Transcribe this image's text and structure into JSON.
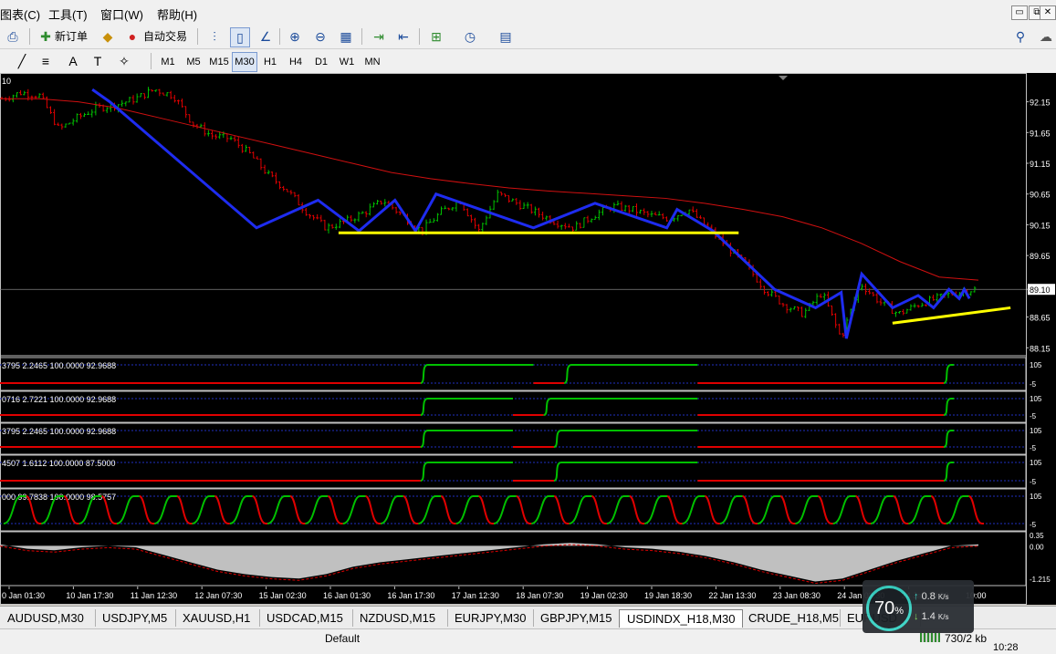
{
  "menu": {
    "items": [
      "图表(C)",
      "工具(T)",
      "窗口(W)",
      "帮助(H)"
    ],
    "window_buttons": [
      "▭",
      "⧉",
      "✕"
    ]
  },
  "toolbar": {
    "new_order_label": "新订单",
    "auto_trade_label": "自动交易",
    "icons": [
      "print-icon",
      "new-order-icon",
      "history-icon",
      "auto-trade-icon",
      "bar-chart-icon",
      "candle-chart-icon",
      "line-chart-icon",
      "zoom-in-icon",
      "zoom-out-icon",
      "tile-windows-icon",
      "auto-scroll-icon",
      "chart-shift-icon",
      "indicators-icon",
      "periods-icon",
      "templates-icon",
      "search-icon",
      "chat-icon"
    ]
  },
  "timeframes": [
    "M1",
    "M5",
    "M15",
    "M30",
    "H1",
    "H4",
    "D1",
    "W1",
    "MN"
  ],
  "active_timeframe": "M30",
  "chart_data": [
    {
      "type": "line",
      "title": "",
      "corner_label": "10",
      "yticks": [
        "92.15",
        "91.65",
        "91.15",
        "90.65",
        "90.15",
        "89.65",
        "89.10",
        "88.65",
        "88.15"
      ],
      "current_price_label": "89.10",
      "ylim": [
        88.05,
        92.5
      ],
      "xticks": [
        "0 Jan 01:30",
        "10 Jan 17:30",
        "11 Jan 12:30",
        "12 Jan 07:30",
        "15 Jan 02:30",
        "16 Jan 01:30",
        "16 Jan 17:30",
        "17 Jan 12:30",
        "18 Jan 07:30",
        "19 Jan 02:30",
        "19 Jan 18:30",
        "22 Jan 13:30",
        "23 Jan 08:30",
        "24 Jan 03:30",
        "24 Jan 19:30",
        "10:00"
      ],
      "price_series": [
        92.2,
        92.3,
        92.25,
        91.7,
        91.9,
        92.05,
        92.1,
        92.2,
        92.35,
        92.25,
        91.8,
        91.6,
        91.55,
        91.3,
        90.95,
        90.7,
        90.35,
        90.1,
        90.2,
        90.35,
        90.55,
        90.3,
        90.05,
        90.35,
        90.55,
        90.05,
        90.65,
        90.5,
        90.35,
        90.2,
        90.1,
        90.3,
        90.45,
        90.4,
        90.3,
        90.25,
        90.4,
        90.1,
        89.8,
        89.5,
        89.1,
        88.85,
        88.7,
        89.05,
        88.3,
        89.2,
        88.9,
        88.7,
        88.85,
        88.95,
        89.05,
        89.1
      ],
      "ma_series": [
        92.2,
        92.2,
        92.15,
        92.05,
        91.9,
        91.75,
        91.6,
        91.45,
        91.3,
        91.15,
        91.0,
        90.9,
        90.82,
        90.75,
        90.7,
        90.66,
        90.62,
        90.58,
        90.5,
        90.4,
        90.28,
        90.1,
        89.85,
        89.55,
        89.3,
        89.25
      ],
      "trendlines": [
        {
          "color": "#1e2cf0",
          "points": [
            [
              0.09,
              92.35
            ],
            [
              0.107,
              92.15
            ],
            [
              0.25,
              90.1
            ],
            [
              0.31,
              90.55
            ],
            [
              0.35,
              90.05
            ],
            [
              0.385,
              90.55
            ],
            [
              0.405,
              90.05
            ],
            [
              0.425,
              90.65
            ],
            [
              0.52,
              90.1
            ],
            [
              0.58,
              90.5
            ],
            [
              0.65,
              90.1
            ],
            [
              0.66,
              90.4
            ],
            [
              0.695,
              90.05
            ],
            [
              0.755,
              89.1
            ],
            [
              0.795,
              88.8
            ],
            [
              0.82,
              89.05
            ],
            [
              0.825,
              88.3
            ],
            [
              0.84,
              89.35
            ],
            [
              0.87,
              88.8
            ],
            [
              0.895,
              89.0
            ],
            [
              0.91,
              88.8
            ],
            [
              0.925,
              89.1
            ],
            [
              0.935,
              88.95
            ],
            [
              0.94,
              89.1
            ],
            [
              0.945,
              88.95
            ]
          ]
        },
        {
          "color": "#ffff00",
          "points": [
            [
              0.33,
              90.02
            ],
            [
              0.72,
              90.02
            ]
          ]
        },
        {
          "color": "#ffff00",
          "points": [
            [
              0.87,
              88.55
            ],
            [
              0.985,
              88.8
            ]
          ]
        }
      ]
    },
    {
      "type": "line",
      "label": "3795 2.2465 100.0000 92.9688",
      "ticks": [
        "105",
        "-5"
      ],
      "high": [
        [
          0.41,
          0.52
        ],
        [
          0.55,
          0.68
        ],
        [
          0.92,
          0.93
        ]
      ],
      "low": [
        [
          0,
          0.41
        ],
        [
          0.52,
          0.55
        ],
        [
          0.68,
          0.92
        ]
      ]
    },
    {
      "type": "line",
      "label": "0716 2.7221 100.0000 92.9688",
      "ticks": [
        "105",
        "-5"
      ],
      "high": [
        [
          0.41,
          0.5
        ],
        [
          0.53,
          0.68
        ],
        [
          0.92,
          0.93
        ]
      ],
      "low": [
        [
          0,
          0.41
        ],
        [
          0.5,
          0.53
        ],
        [
          0.68,
          0.92
        ]
      ]
    },
    {
      "type": "line",
      "label": "3795 2.2465 100.0000 92.9688",
      "ticks": [
        "105",
        "-5"
      ],
      "high": [
        [
          0.41,
          0.5
        ],
        [
          0.54,
          0.68
        ],
        [
          0.92,
          0.93
        ]
      ],
      "low": [
        [
          0,
          0.41
        ],
        [
          0.5,
          0.54
        ],
        [
          0.68,
          0.92
        ]
      ]
    },
    {
      "type": "line",
      "label": "4507 1.6112 100.0000 87.5000",
      "ticks": [
        "105",
        "-5"
      ],
      "high": [
        [
          0.41,
          0.5
        ],
        [
          0.54,
          0.68
        ],
        [
          0.92,
          0.93
        ]
      ],
      "low": [
        [
          0,
          0.41
        ],
        [
          0.5,
          0.54
        ],
        [
          0.68,
          0.92
        ]
      ]
    },
    {
      "type": "line",
      "label": "000 99.7838 100.0000 98.5757",
      "ticks": [
        "105",
        "-5"
      ],
      "cycles": 26
    },
    {
      "type": "area",
      "ticks": [
        "0.35",
        "0.00",
        "-1.215"
      ],
      "values": [
        0.05,
        -0.1,
        -0.15,
        -0.05,
        0.0,
        -0.05,
        -0.3,
        -0.55,
        -0.8,
        -0.95,
        -1.05,
        -1.1,
        -0.95,
        -0.7,
        -0.55,
        -0.45,
        -0.35,
        -0.25,
        -0.15,
        -0.05,
        0.05,
        0.1,
        0.05,
        -0.05,
        -0.1,
        -0.2,
        -0.35,
        -0.55,
        -0.8,
        -1.0,
        -1.2,
        -1.1,
        -0.8,
        -0.5,
        -0.25,
        0.0,
        0.05
      ]
    }
  ],
  "tabs": [
    "AUDUSD,M30",
    "USDJPY,M5",
    "XAUUSD,H1",
    "USDCAD,M15",
    "NZDUSD,M15",
    "EURJPY,M30",
    "GBPJPY,M15",
    "USDINDX_H18,M30",
    "CRUDE_H18,M5",
    "EURUSD"
  ],
  "active_tab": "USDINDX_H18,M30",
  "status": {
    "profile": "Default",
    "traffic": "730/2 kb",
    "clock": "10:28"
  },
  "speed_widget": {
    "percent": "70",
    "percent_sign": "%",
    "upload": "0.8",
    "download": "1.4",
    "unit": "K/s"
  },
  "colors": {
    "bull": "#00c000",
    "bear": "#e00000",
    "trend": "#1e2cf0",
    "support": "#ffff00",
    "ma": "#d01010"
  }
}
